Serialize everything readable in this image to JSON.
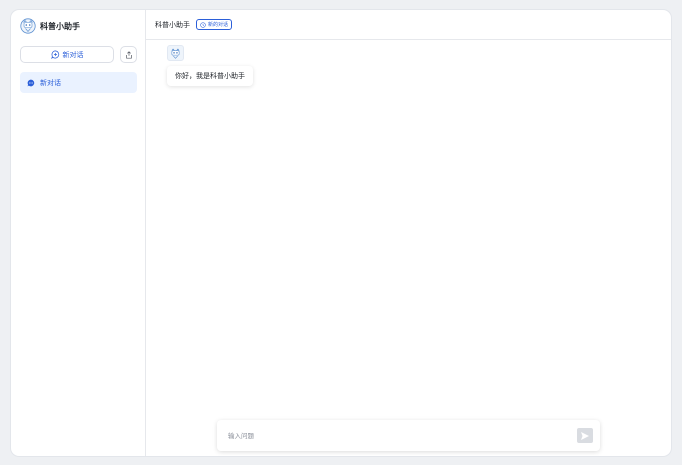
{
  "sidebar": {
    "brand": {
      "name": "科普小助手",
      "logo_icon": "robot-cat-icon"
    },
    "new_chat_label": "新对话",
    "conversations": [
      {
        "label": "新对话",
        "active": true
      }
    ]
  },
  "header": {
    "title": "科普小助手",
    "history_label": "新的对话"
  },
  "chat": {
    "messages": [
      {
        "role": "assistant",
        "text": "你好，我是科普小助手"
      }
    ]
  },
  "composer": {
    "placeholder": "输入问题",
    "value": ""
  },
  "colors": {
    "accent": "#2b5fd9",
    "active_bg": "#eaf2ff",
    "send_disabled": "#d9dce1"
  }
}
